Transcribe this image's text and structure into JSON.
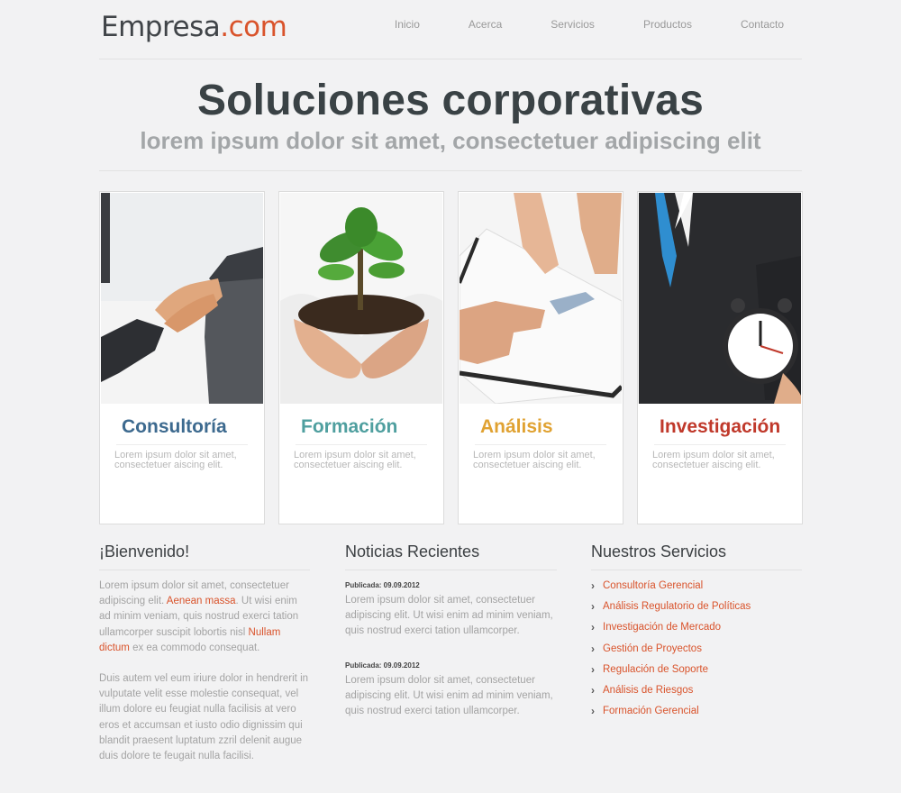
{
  "logo": {
    "part1": "Empresa",
    "part2": ".com"
  },
  "nav": [
    "Inicio",
    "Acerca",
    "Servicios",
    "Productos",
    "Contacto"
  ],
  "hero": {
    "title": "Soluciones corporativas",
    "subtitle": "lorem ipsum dolor sit amet, consectetuer adipiscing elit"
  },
  "cards": [
    {
      "title": "Consultoría",
      "text": "Lorem ipsum dolor sit amet, consectetuer aiscing elit.",
      "color": "#3d6a8f",
      "image": "handshake-image"
    },
    {
      "title": "Formación",
      "text": "Lorem ipsum dolor sit amet, consectetuer aiscing elit.",
      "color": "#4f9f9f",
      "image": "plant-in-hands-image"
    },
    {
      "title": "Análisis",
      "text": "Lorem ipsum dolor sit amet, consectetuer aiscing elit.",
      "color": "#e0a232",
      "image": "hands-with-documents-image"
    },
    {
      "title": "Investigación",
      "text": "Lorem ipsum dolor sit amet, consectetuer aiscing elit.",
      "color": "#c0392b",
      "image": "businessman-with-clock-image"
    }
  ],
  "welcome": {
    "heading": "¡Bienvenido!",
    "p1_a": "Lorem ipsum dolor sit amet, consectetuer adipiscing elit. ",
    "p1_link1": "Aenean massa",
    "p1_b": ". Ut wisi enim ad minim veniam, quis nostrud exerci tation ullamcorper suscipit lobortis nisl ",
    "p1_link2": "Nullam dictum",
    "p1_c": " ex ea commodo consequat.",
    "p2": "Duis autem vel eum iriure dolor in hendrerit in vulputate velit esse molestie consequat, vel illum dolore eu feugiat nulla facilisis at vero eros et accumsan et iusto odio dignissim qui blandit praesent luptatum zzril delenit augue duis dolore te feugait nulla facilisi."
  },
  "news": {
    "heading": "Noticias Recientes",
    "items": [
      {
        "date": "Publicada: 09.09.2012",
        "text": "Lorem ipsum dolor sit amet, consectetuer adipiscing elit. Ut wisi enim ad minim veniam, quis nostrud exerci tation ullamcorper."
      },
      {
        "date": "Publicada: 09.09.2012",
        "text": "Lorem ipsum dolor sit amet, consectetuer adipiscing elit. Ut wisi enim ad minim veniam, quis nostrud exerci tation ullamcorper."
      }
    ]
  },
  "services": {
    "heading": "Nuestros Servicios",
    "items": [
      "Consultoría Gerencial",
      "Análisis Regulatorio de Políticas",
      "Investigación de Mercado",
      "Gestión de Proyectos",
      "Regulación de Soporte",
      "Análisis de Riesgos",
      "Formación Gerencial"
    ],
    "bullet": "›"
  },
  "colors": {
    "accent": "#d9532b",
    "background": "#f2f2f3",
    "heading": "#3a4245"
  }
}
